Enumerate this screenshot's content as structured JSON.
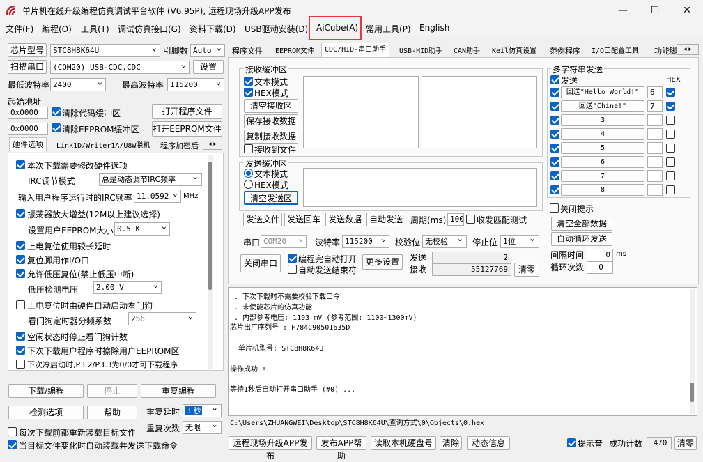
{
  "app_title": "单片机在线升级编程仿真调试平台软件 (V6.95P), 远程现场升级APP发布",
  "menu": [
    "文件(F)",
    "编程(O)",
    "工具(T)",
    "调试仿真接口(G)",
    "资料下载(D)",
    "USB驱动安装(D)",
    "AiCube(A)",
    "常用工具(P)",
    "English"
  ],
  "left": {
    "chip_label": "芯片型号",
    "chip_value": "STC8H8K64U",
    "pin_label": "引脚数",
    "pin_value": "Auto",
    "scan_port": "扫描串口",
    "port_value": "(COM20) USB-CDC,CDC",
    "settings": "设置",
    "min_baud_label": "最低波特率",
    "min_baud": "2400",
    "max_baud_label": "最高波特率",
    "max_baud": "115200",
    "start_addr_label": "起始地址",
    "addr1": "0x0000",
    "clear_code": "清除代码缓冲区",
    "open_prog": "打开程序文件",
    "addr2": "0x0000",
    "clear_eeprom": "清除EEPROM缓冲区",
    "open_eeprom": "打开EEPROM文件",
    "tabs": [
      "硬件选项",
      "Link1D/Writer1A/U8W脱机",
      "程序加密后"
    ],
    "hw": {
      "opt1": "本次下载需要修改硬件选项",
      "irc_mode_label": "IRC调节模式",
      "irc_mode": "总是动态调节IRC频率",
      "irc_freq_label": "输入用户程序运行时的IRC频率",
      "irc_freq": "11.0592",
      "mhz": "MHz",
      "opt2": "振荡器放大增益(12M以上建议选择)",
      "eeprom_size_label": "设置用户EEPROM大小",
      "eeprom_size": "0.5 K",
      "opt3": "上电复位使用较长延时",
      "opt4": "复位脚用作I/O口",
      "opt5": "允许低压复位(禁止低压中断)",
      "lvd_label": "低压检测电压",
      "lvd": "2.00 V",
      "opt6": "上电复位时由硬件自动启动看门狗",
      "wdt_label": "看门狗定时器分频系数",
      "wdt": "256",
      "opt7": "空闲状态时停止看门狗计数",
      "opt8": "下次下载用户程序时擦除用户EEPROM区",
      "opt9": "下次冷启动时,P3.2/P3.3为0/0才可下载程序"
    },
    "download": "下载/编程",
    "stop": "停止",
    "reprog": "重复编程",
    "detect": "检测选项",
    "help": "帮助",
    "repeat_delay_label": "重复延时",
    "repeat_delay": "3 秒",
    "repeat_count_label": "重复次数",
    "repeat_count": "无限",
    "reload_each": "每次下载前都重新装载目标文件",
    "auto_reload": "当目标文件变化时自动装载并发送下载命令"
  },
  "right_tabs": [
    "程序文件",
    "EEPROM文件",
    "CDC/HID-串口助手",
    "USB-HID助手",
    "CAN助手",
    "Keil仿真设置",
    "范例程序",
    "I/O口配置工具",
    "功能脚"
  ],
  "serial": {
    "recv_group": "接收缓冲区",
    "text_mode": "文本模式",
    "hex_mode": "HEX模式",
    "clear_recv": "清空接收区",
    "save_recv": "保存接收数据",
    "copy_recv": "复制接收数据",
    "recv_to_file": "接收到文件",
    "send_group": "发送缓冲区",
    "clear_send": "清空发送区",
    "send_file": "发送文件",
    "send_return": "发送回车",
    "send_data": "发送数据",
    "auto_send": "自动发送",
    "period_label": "周期(ms)",
    "period": "100",
    "recv_match": "收发匹配测试",
    "port_label": "串口",
    "port": "COM20",
    "baud_label": "波特率",
    "baud": "115200",
    "parity_label": "校验位",
    "parity": "无校验",
    "stop_label": "停止位",
    "stop": "1位",
    "close_port": "关闭串口",
    "auto_open": "编程完自动打开",
    "auto_send_end": "自动发送结束符",
    "more": "更多设置",
    "send_label": "发送",
    "send_count": "2",
    "recv_label": "接收",
    "recv_count": "55127769",
    "clear": "清零"
  },
  "multi": {
    "group": "多字符串发送",
    "send_hdr": "发送",
    "hex_hdr": "HEX",
    "rows": [
      {
        "label": "回送\"Hello World!\"",
        "num": "6",
        "hex": true,
        "chk": true
      },
      {
        "label": "回送\"China!\"",
        "num": "7",
        "hex": true,
        "chk": true
      },
      {
        "label": "3",
        "num": "",
        "hex": false,
        "chk": true
      },
      {
        "label": "4",
        "num": "",
        "hex": false,
        "chk": true
      },
      {
        "label": "5",
        "num": "",
        "hex": false,
        "chk": true
      },
      {
        "label": "6",
        "num": "",
        "hex": false,
        "chk": true
      },
      {
        "label": "7",
        "num": "",
        "hex": false,
        "chk": true
      },
      {
        "label": "8",
        "num": "",
        "hex": false,
        "chk": true
      }
    ],
    "close_tip": "关闭提示",
    "clear_all": "清空全部数据",
    "auto_loop": "自动循环发送",
    "interval_label": "间隔时间",
    "interval": "0",
    "ms": "ms",
    "loop_label": "循环次数",
    "loop": "0"
  },
  "log": [
    " . 下次下载时不需要校验下载口令",
    " . 未使能芯片的仿真功能",
    " . 内部参考电压: 1193 mV (参考范围: 1100~1300mV)",
    "芯片出厂序列号 : F784C90501635D",
    "",
    "  单片机型号: STC8H8K64U",
    "",
    "操作成功 !",
    "",
    "等待1秒后自动打开串口助手 (#0) ..."
  ],
  "path": "C:\\Users\\ZHUANGWEI\\Desktop\\STC8H8K64U\\查询方式\\0\\Objects\\0.hex",
  "bottom": {
    "remote": "远程现场升级APP发布",
    "publish_help": "发布APP帮助",
    "read_disk": "读取本机硬盘号",
    "clear": "清除",
    "dynamic": "动态信息",
    "beep": "提示音",
    "success_label": "成功计数",
    "success": "470",
    "reset": "清零"
  },
  "colors": {
    "accent": "#0a64c8",
    "highlight": "#e8383d"
  }
}
